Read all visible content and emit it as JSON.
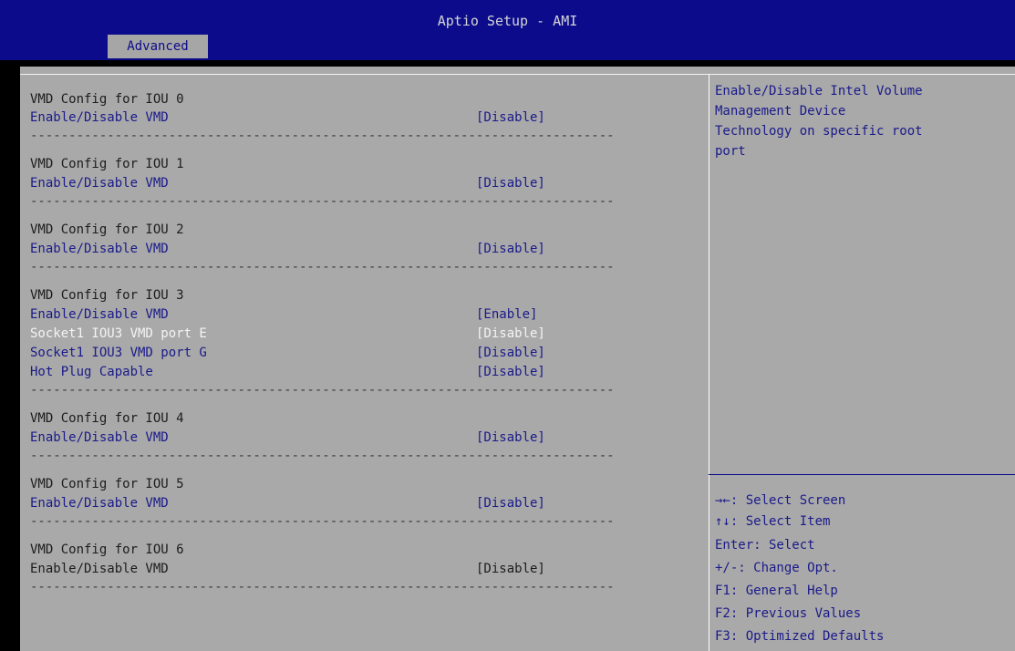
{
  "header": {
    "title": "Aptio Setup - AMI",
    "tab": "Advanced"
  },
  "settings": [
    {
      "heading": "VMD Config for IOU 0",
      "items": [
        {
          "label": "Enable/Disable VMD",
          "value": "[Disable]"
        }
      ],
      "separator": "----------------------------------------------------------------------------"
    },
    {
      "heading": "VMD Config for IOU 1",
      "items": [
        {
          "label": "Enable/Disable VMD",
          "value": "[Disable]"
        }
      ],
      "separator": "----------------------------------------------------------------------------"
    },
    {
      "heading": "VMD Config for IOU 2",
      "items": [
        {
          "label": "Enable/Disable VMD",
          "value": "[Disable]"
        }
      ],
      "separator": "----------------------------------------------------------------------------"
    },
    {
      "heading": "VMD Config for IOU 3",
      "items": [
        {
          "label": "Enable/Disable VMD",
          "value": "[Enable]"
        },
        {
          "label": "Socket1 IOU3 VMD port E",
          "value": "[Disable]"
        },
        {
          "label": "Socket1 IOU3 VMD port G",
          "value": "[Disable]"
        },
        {
          "label": "Hot Plug Capable",
          "value": "[Disable]"
        }
      ],
      "separator": "----------------------------------------------------------------------------"
    },
    {
      "heading": "VMD Config for IOU 4",
      "items": [
        {
          "label": "Enable/Disable VMD",
          "value": "[Disable]"
        }
      ],
      "separator": "----------------------------------------------------------------------------"
    },
    {
      "heading": "VMD Config for IOU 5",
      "items": [
        {
          "label": "Enable/Disable VMD",
          "value": "[Disable]"
        }
      ],
      "separator": "----------------------------------------------------------------------------"
    },
    {
      "heading": "VMD Config for IOU 6",
      "items": [
        {
          "label": "Enable/Disable VMD",
          "value": "[Disable]"
        }
      ],
      "separator": "----------------------------------------------------------------------------"
    }
  ],
  "help": {
    "lines": [
      "Enable/Disable Intel Volume",
      "Management Device",
      "Technology on specific root",
      "port"
    ]
  },
  "keys": [
    "→←: Select Screen",
    "↑↓: Select Item",
    "Enter: Select",
    "+/-: Change Opt.",
    "F1: General Help",
    "F2: Previous Values",
    "F3: Optimized Defaults"
  ],
  "colors": {
    "header_bg": "#0b0b8c",
    "panel_bg": "#a9a9a9",
    "option_text": "#1a1a8a",
    "selected_text": "#f4f4f4"
  }
}
